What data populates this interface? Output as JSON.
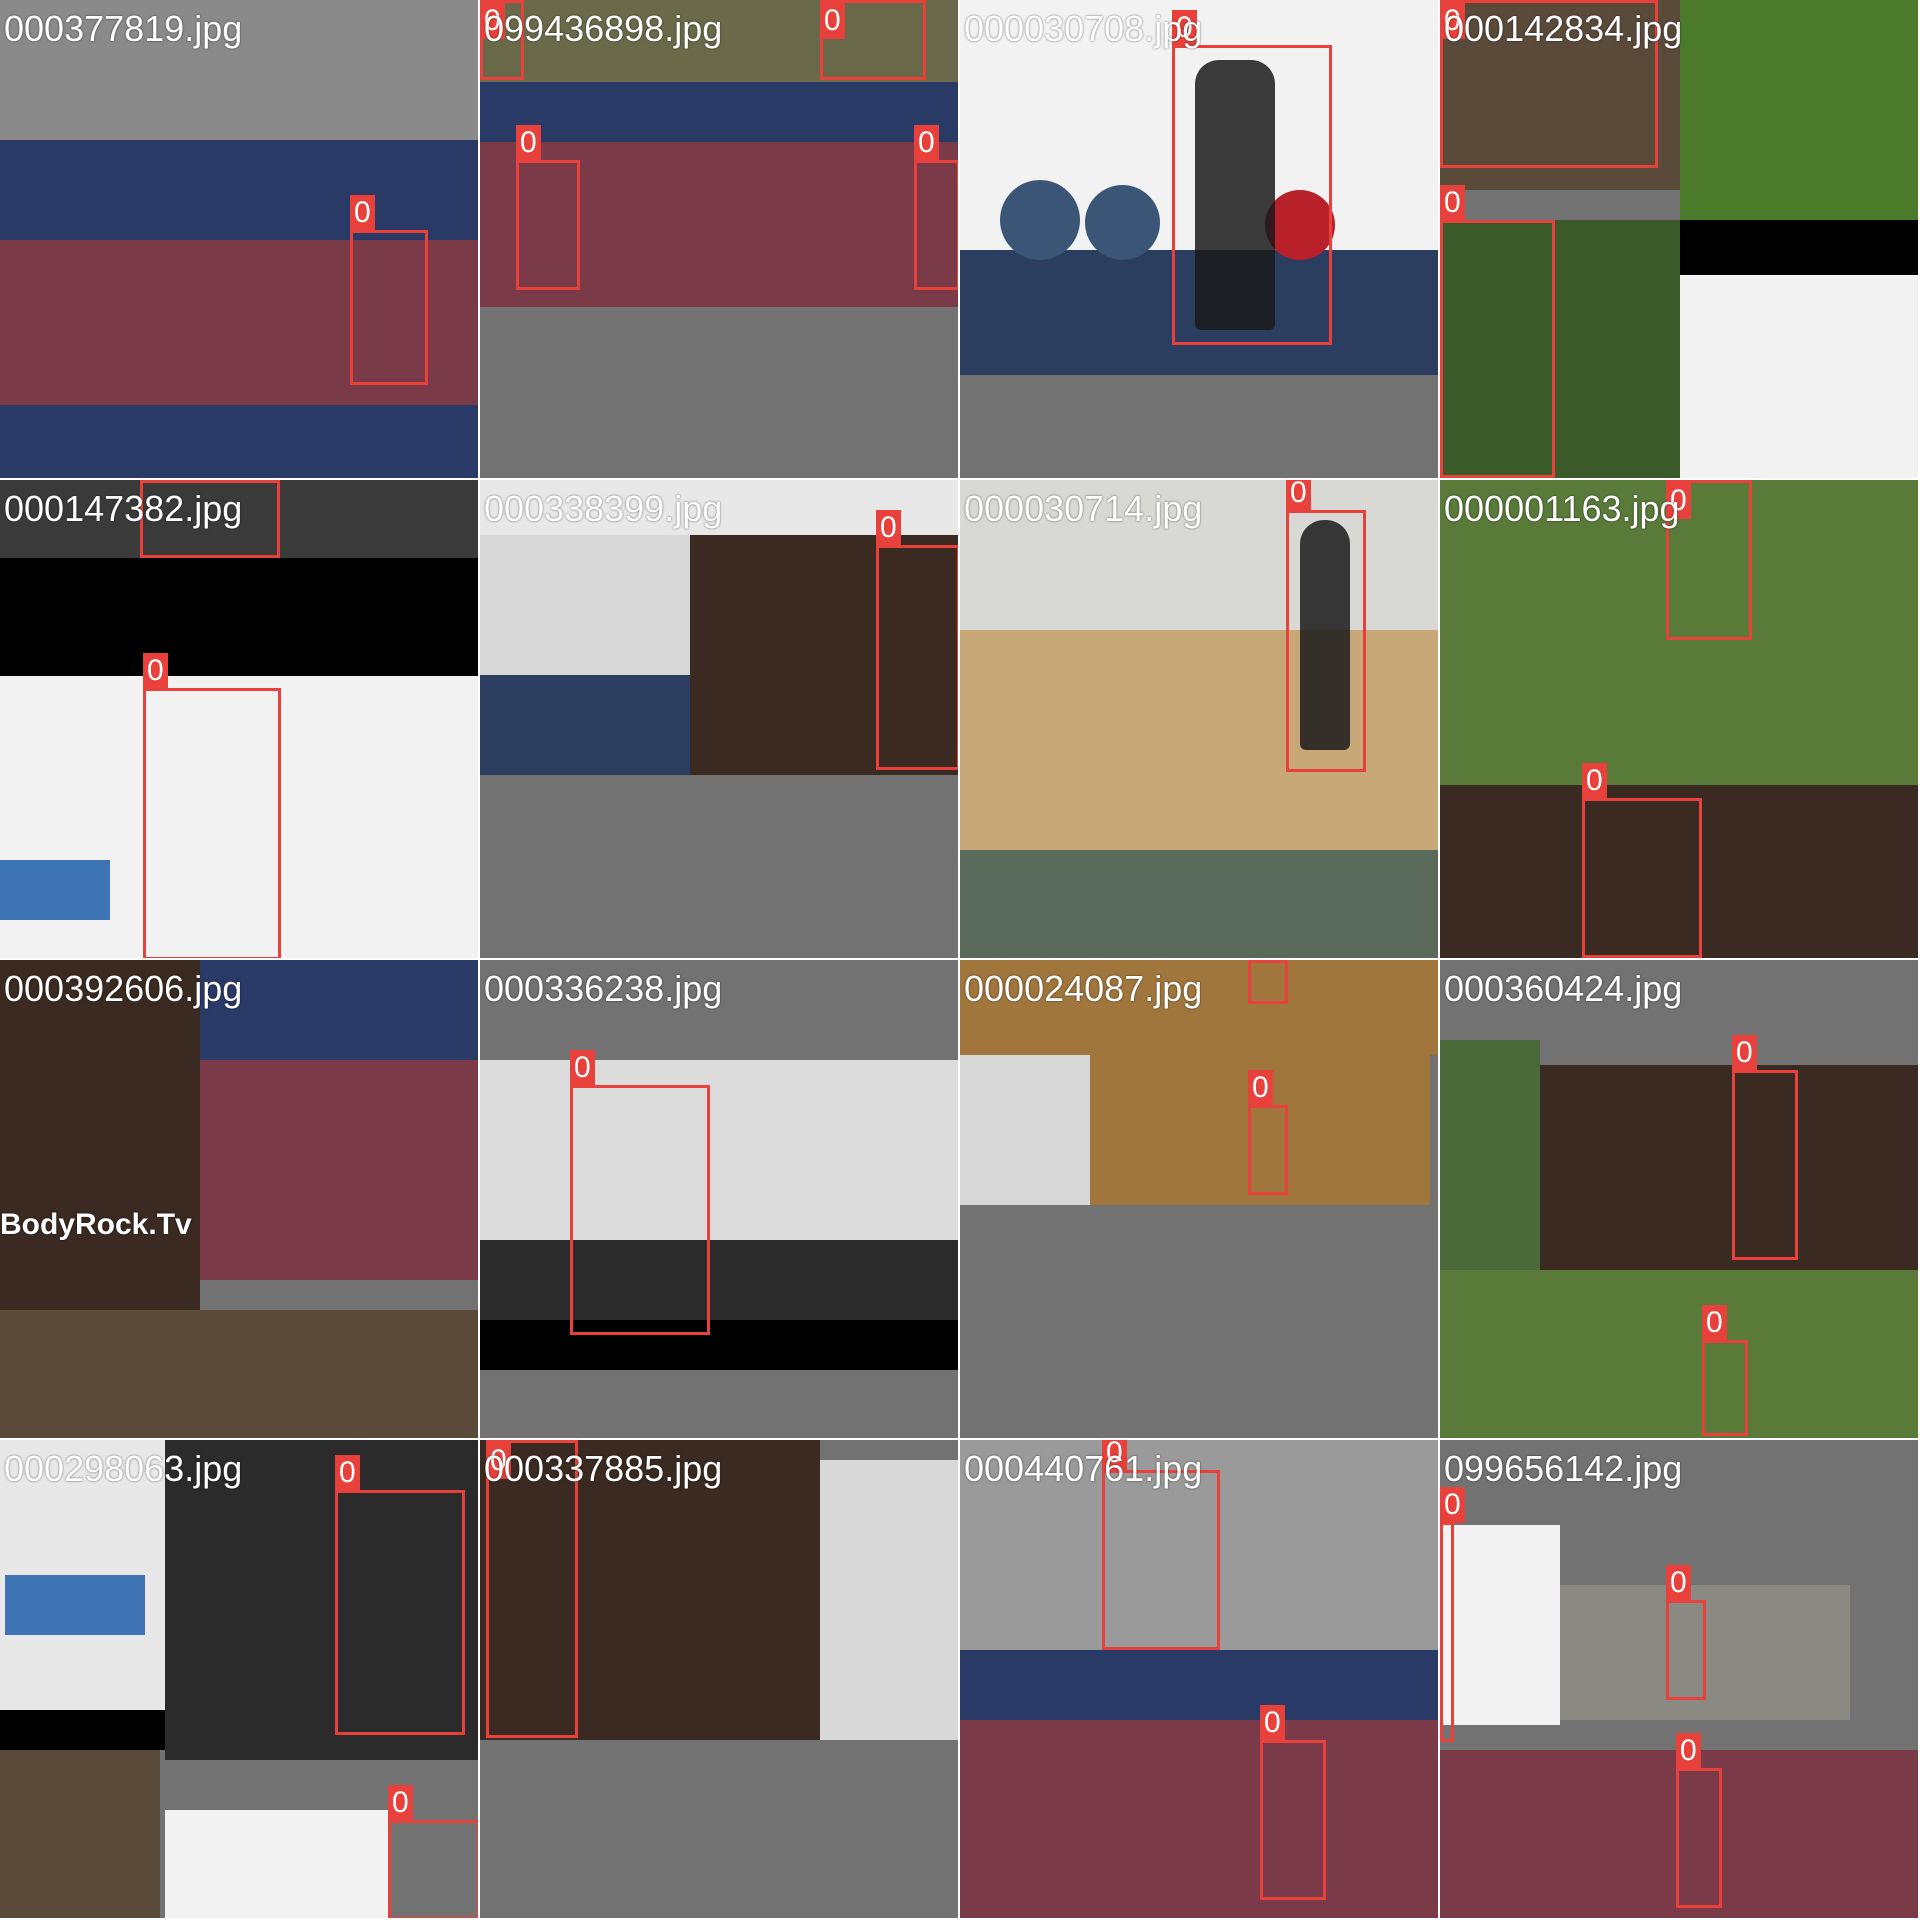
{
  "tiles": [
    {
      "filename": "000377819.jpg",
      "label": "0"
    },
    {
      "filename": "099436898.jpg",
      "label": "0"
    },
    {
      "filename": "000030708.jpg",
      "label": "0"
    },
    {
      "filename": "000142834.jpg",
      "label": "0"
    },
    {
      "filename": "000147382.jpg",
      "label": "0"
    },
    {
      "filename": "000338399.jpg",
      "label": "0"
    },
    {
      "filename": "000030714.jpg",
      "label": "0"
    },
    {
      "filename": "000001163.jpg",
      "label": "0"
    },
    {
      "filename": "000392606.jpg",
      "label": "0"
    },
    {
      "filename": "000336238.jpg",
      "label": "0"
    },
    {
      "filename": "000024087.jpg",
      "label": "0"
    },
    {
      "filename": "000360424.jpg",
      "label": "0"
    },
    {
      "filename": "000298063.jpg",
      "label": "0"
    },
    {
      "filename": "000337885.jpg",
      "label": "0"
    },
    {
      "filename": "000440761.jpg",
      "label": "0"
    },
    {
      "filename": "099656142.jpg",
      "label": "0"
    }
  ],
  "colors": {
    "box": "#e8403a",
    "court_red": "#7a3a48",
    "court_blue": "#2a3a66",
    "gym_floor": "#2b3e60",
    "wood_floor": "#a0763d",
    "grass": "#5a7a3a",
    "wall_white": "#f2f2f2",
    "gray_pad": "#727272"
  },
  "watermark": "BodyRock.Tv"
}
